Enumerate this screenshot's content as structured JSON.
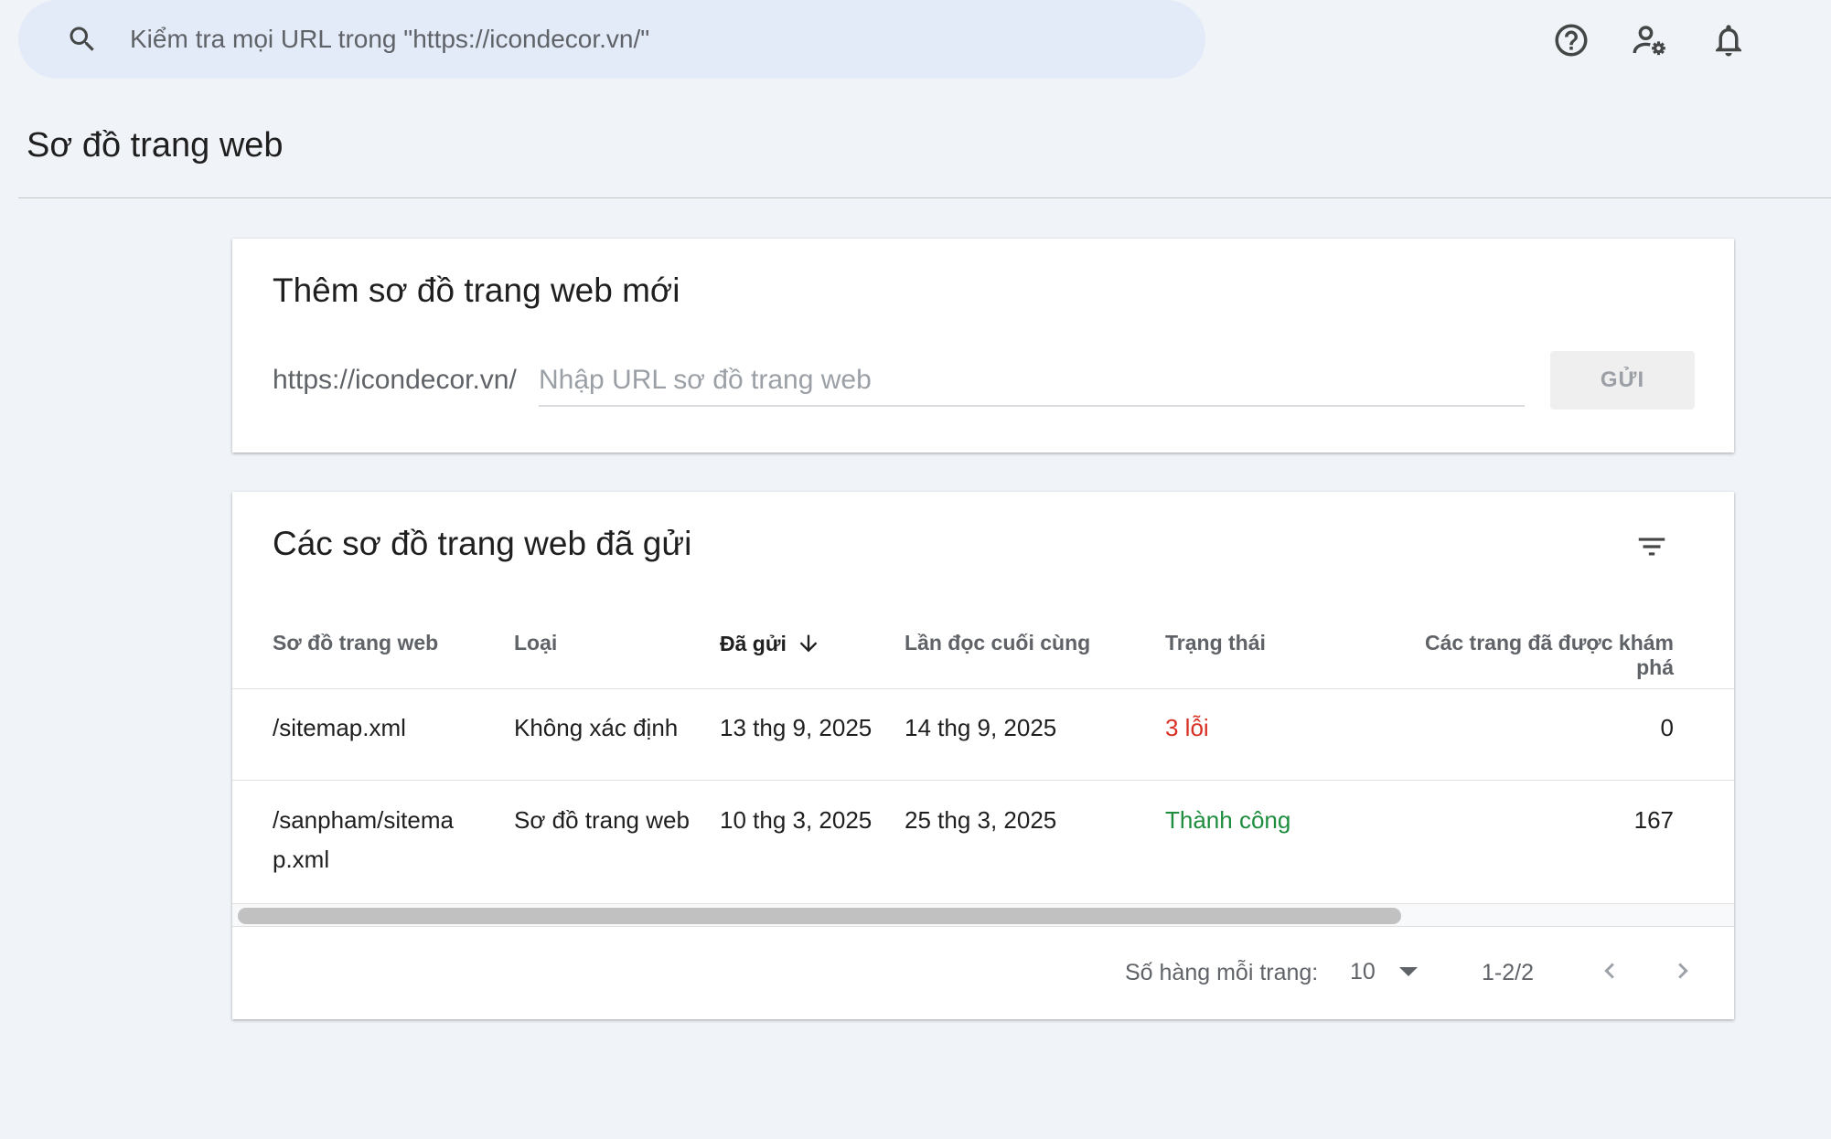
{
  "search": {
    "placeholder": "Kiểm tra mọi URL trong \"https://icondecor.vn/\""
  },
  "header_icons": [
    "help-icon",
    "admin-settings-icon",
    "notifications-icon"
  ],
  "page": {
    "title": "Sơ đồ trang web"
  },
  "add_sitemap": {
    "title": "Thêm sơ đồ trang web mới",
    "prefix": "https://icondecor.vn/",
    "input_placeholder": "Nhập URL sơ đồ trang web",
    "submit_label": "GỬI"
  },
  "submitted_sitemaps": {
    "title": "Các sơ đồ trang web đã gửi",
    "columns": {
      "sitemap": "Sơ đồ trang web",
      "type": "Loại",
      "submitted": "Đã gửi",
      "last_read": "Lần đọc cuối cùng",
      "status": "Trạng thái",
      "discovered_pages": "Các trang đã được khám phá"
    },
    "rows": [
      {
        "sitemap": "/sitemap.xml",
        "type": "Không xác định",
        "submitted": "13 thg 9, 2025",
        "last_read": "14 thg 9, 2025",
        "status": "3 lỗi",
        "discovered_pages": "0"
      },
      {
        "sitemap_line1": "/sanpham/sitema",
        "sitemap_line2": "p.xml",
        "type": "Sơ đồ trang web",
        "submitted": "10 thg 3, 2025",
        "last_read": "25 thg 3, 2025",
        "status": "Thành công",
        "discovered_pages": "167"
      }
    ],
    "pagination": {
      "rows_per_page_label": "Số hàng mỗi trang:",
      "rows_per_page_value": "10",
      "range": "1-2/2"
    }
  },
  "colors": {
    "background": "#f0f4f9",
    "search_bg": "#e3eaf8",
    "error": "#d93025",
    "success": "#1e8e3e"
  }
}
